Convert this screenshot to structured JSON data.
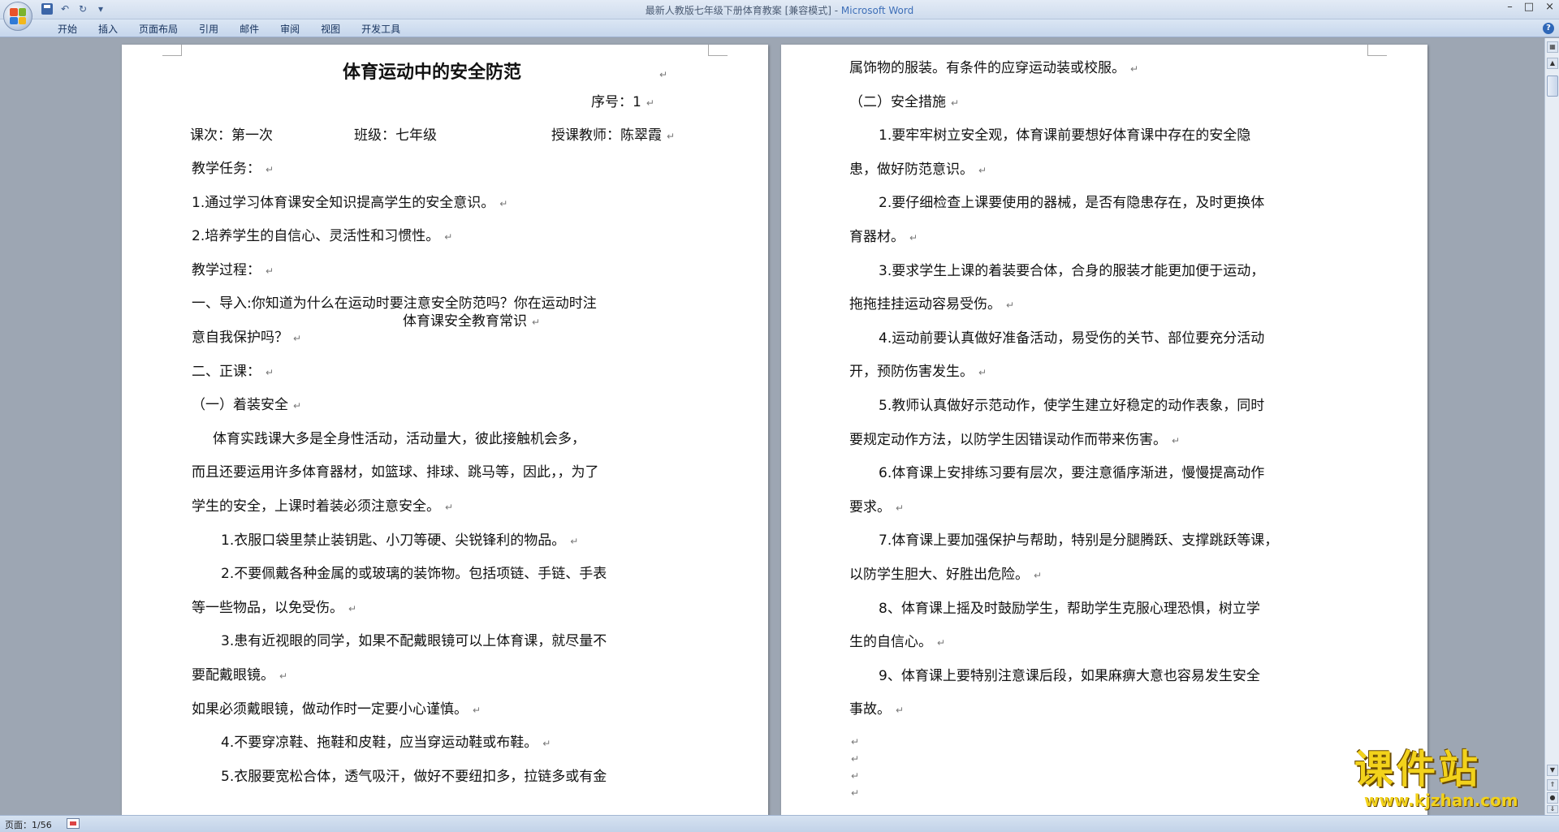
{
  "window": {
    "title": "最新人教版七年级下册体育教案 [兼容模式] - ",
    "app_name": "Microsoft Word",
    "controls": {
      "minimize": "–",
      "maximize": "□",
      "close": "×"
    }
  },
  "quick_access": {
    "undo": "↶",
    "redo": "↻",
    "customize": "▾"
  },
  "ribbon_tabs": [
    "开始",
    "插入",
    "页面布局",
    "引用",
    "邮件",
    "审阅",
    "视图",
    "开发工具"
  ],
  "help": "?",
  "left_page": {
    "title": "体育运动中的安全防范",
    "serial": "序号：1",
    "class_info": {
      "lesson": "课次：第一次",
      "class": "班级：七年级",
      "teacher": "授课教师：陈翠霞"
    },
    "lines": [
      "教学任务：",
      "1.通过学习体育课安全知识提高学生的安全意识。",
      "2.培养学生的自信心、灵活性和习惯性。",
      "教学过程：",
      "一、导入:你知道为什么在运动时要注意安全防范吗？你在运动时注",
      "意自我保护吗？",
      "二、正课：",
      "（一）着装安全",
      "体育实践课大多是全身性活动，活动量大，彼此接触机会多，",
      "而且还要运用许多体育器材，如篮球、排球、跳马等，因此，，为了",
      "学生的安全，上课时着装必须注意安全。",
      "1.衣服口袋里禁止装钥匙、小刀等硬、尖锐锋利的物品。",
      "2.不要佩戴各种金属的或玻璃的装饰物。包括项链、手链、手表",
      "等一些物品，以免受伤。",
      "3.患有近视眼的同学，如果不配戴眼镜可以上体育课，就尽量不",
      "要配戴眼镜。",
      "如果必须戴眼镜，做动作时一定要小心谨慎。",
      "4.不要穿凉鞋、拖鞋和皮鞋，应当穿运动鞋或布鞋。",
      "5.衣服要宽松合体，透气吸汗，做好不要纽扣多，拉链多或有金"
    ],
    "subtitle": "体育课安全教育常识"
  },
  "right_page": {
    "lines": [
      "属饰物的服装。有条件的应穿运动装或校服。",
      "（二）安全措施",
      "1.要牢牢树立安全观，体育课前要想好体育课中存在的安全隐",
      "患，做好防范意识。",
      "2.要仔细检查上课要使用的器械，是否有隐患存在，及时更换体",
      "育器材。",
      "3.要求学生上课的着装要合体，合身的服装才能更加便于运动，",
      "拖拖挂挂运动容易受伤。",
      "4.运动前要认真做好准备活动，易受伤的关节、部位要充分活动",
      "开，预防伤害发生。",
      "5.教师认真做好示范动作，使学生建立好稳定的动作表象，同时",
      "要规定动作方法，以防学生因错误动作而带来伤害。",
      "6.体育课上安排练习要有层次，要注意循序渐进，慢慢提高动作",
      "要求。",
      "7.体育课上要加强保护与帮助，特别是分腿腾跃、支撑跳跃等课，",
      "以防学生胆大、好胜出危险。",
      "8、体育课上摇及时鼓励学生，帮助学生克服心理恐惧，树立学",
      "生的自信心。",
      "9、体育课上要特别注意课后段，如果麻痹大意也容易发生安全",
      "事故。"
    ]
  },
  "paragraph_mark": "↵",
  "statusbar": {
    "page": "页面：1/56"
  },
  "watermark": {
    "name": "课件站",
    "url": "www.kjzhan.com"
  },
  "colors": {
    "accent": "#3e6fb8",
    "watermark": "#f2d21b"
  }
}
